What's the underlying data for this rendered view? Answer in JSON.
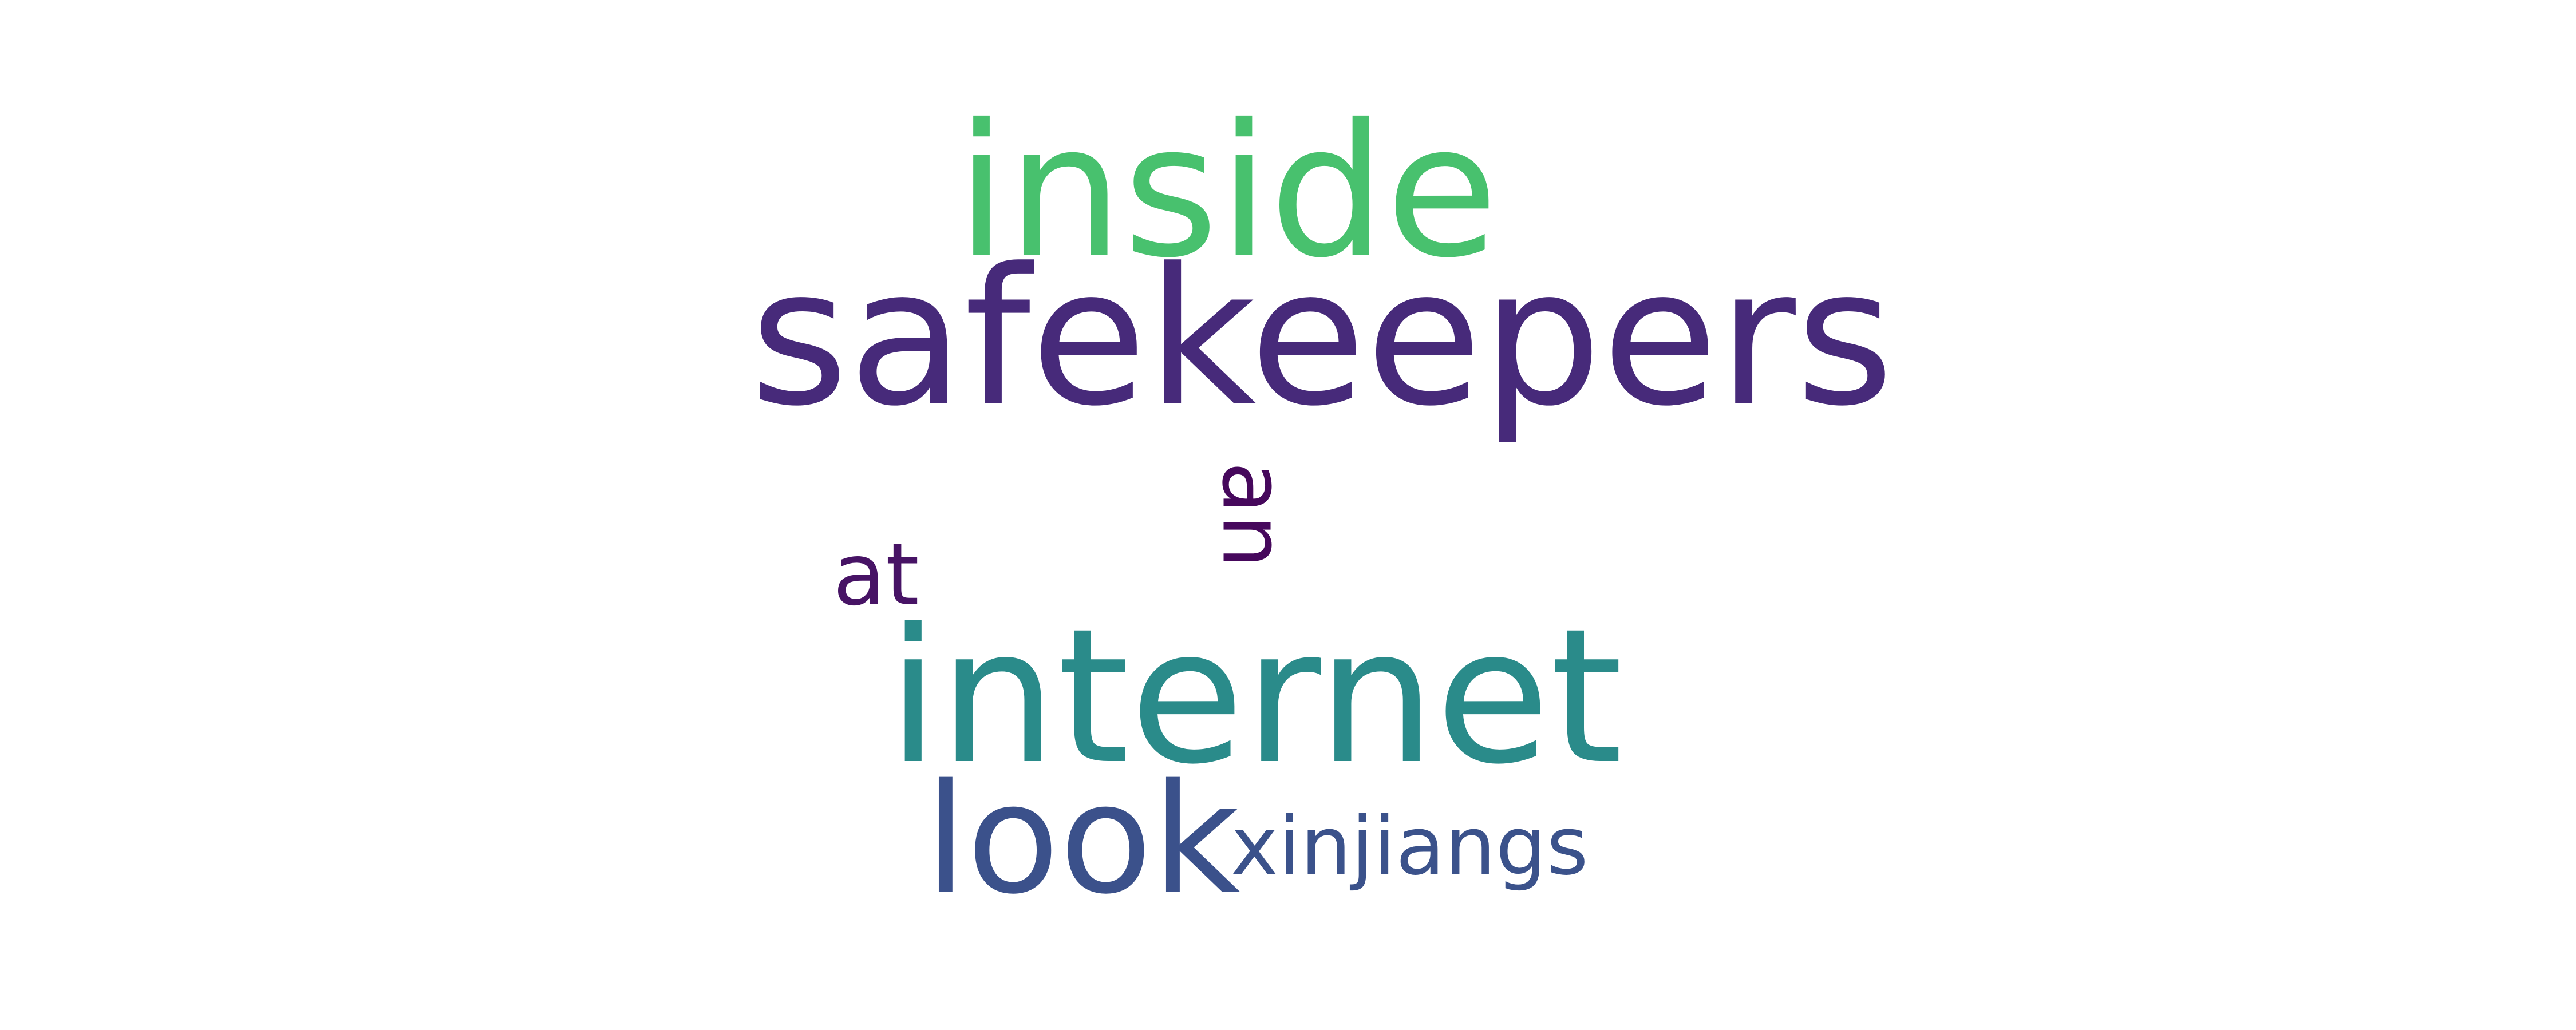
{
  "word_cloud": {
    "background": "#ffffff",
    "words": [
      {
        "text": "inside",
        "color": "#48c16e"
      },
      {
        "text": "safekeepers",
        "color": "#472a7a"
      },
      {
        "text": "internet",
        "color": "#2a8b8a"
      },
      {
        "text": "look",
        "color": "#3b518b"
      },
      {
        "text": "xinjiangs",
        "color": "#3b528b"
      },
      {
        "text": "at",
        "color": "#471365"
      },
      {
        "text": "an",
        "color": "#46085c"
      }
    ]
  }
}
